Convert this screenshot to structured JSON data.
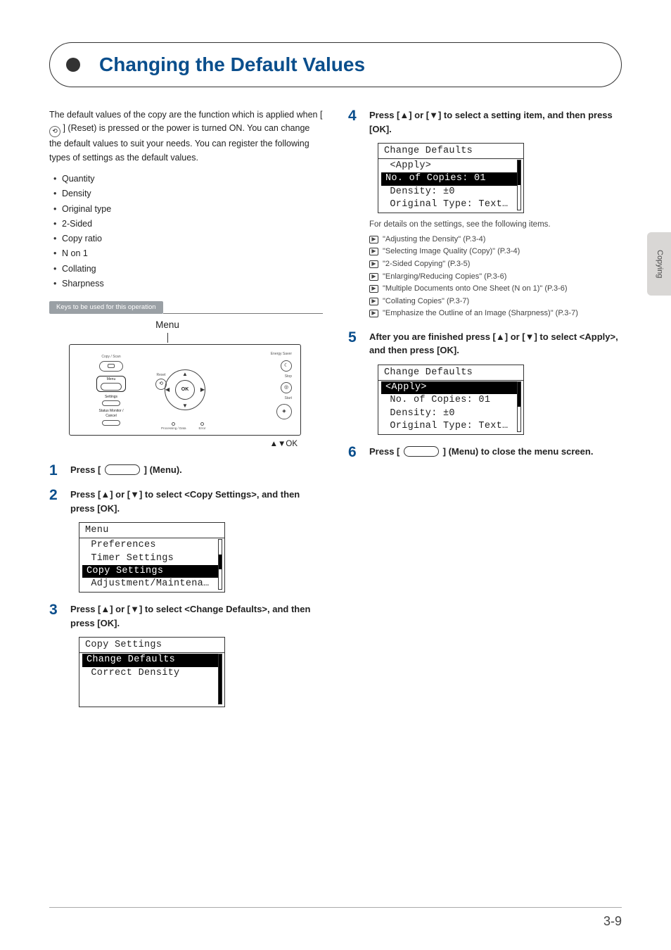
{
  "side_tab": "Copying",
  "section_title": "Changing the Default Values",
  "intro": {
    "p1a": "The default values of the copy are the function which is applied when [",
    "p1b": "] (Reset) is pressed or the power is turned ON. You can change the default values to suit your needs.",
    "p2": "You can register the following types of settings as the default values."
  },
  "bullets": [
    "Quantity",
    "Density",
    "Original type",
    "2-Sided",
    "Copy ratio",
    "N on 1",
    "Collating",
    "Sharpness"
  ],
  "keys_label": "Keys to be used for this operation",
  "menu_label": "Menu",
  "panel_caption": "▲▼OK",
  "panel": {
    "copy_scan": "Copy / Scan",
    "menu_btn": "Menu",
    "settings": "Settings",
    "status": "Status Monitor /\nCancel",
    "reset": "Reset",
    "energy": "Energy Saver",
    "stop": "Stop",
    "start": "Start",
    "processing": "Processing / Data",
    "error": "Error",
    "ok": "OK"
  },
  "steps": {
    "s1": {
      "n": "1",
      "a": "Press [",
      "b": "] (Menu)."
    },
    "s2": {
      "n": "2",
      "t": "Press [▲] or [▼] to select <Copy Settings>, and then press [OK]."
    },
    "s3": {
      "n": "3",
      "t": "Press [▲] or [▼] to select <Change Defaults>, and then press [OK]."
    },
    "s4": {
      "n": "4",
      "t": "Press [▲] or [▼] to select a setting item, and then press [OK]."
    },
    "s5": {
      "n": "5",
      "t": "After you are finished press [▲] or [▼] to select <Apply>, and then press [OK]."
    },
    "s6": {
      "n": "6",
      "a": "Press [",
      "b": "] (Menu) to close the menu screen."
    }
  },
  "lcd_menu": {
    "title": "Menu",
    "r1": " Preferences",
    "r2": " Timer Settings",
    "r3": "Copy Settings",
    "r4": " Adjustment/Maintena…"
  },
  "lcd_copysettings": {
    "title": "Copy Settings",
    "r1": "Change Defaults",
    "r2": " Correct Density"
  },
  "lcd_change1": {
    "title": "Change Defaults",
    "r1": " <Apply>",
    "r2": "No. of Copies: 01",
    "r3": " Density: ±0",
    "r4": " Original Type: Text…"
  },
  "lcd_change2": {
    "title": "Change Defaults",
    "r1": "<Apply>",
    "r2": " No. of Copies: 01",
    "r3": " Density: ±0",
    "r4": " Original Type: Text…"
  },
  "refs": {
    "intro": "For details on the settings, see the following items.",
    "items": [
      "\"Adjusting the Density\" (P.3-4)",
      "\"Selecting Image Quality (Copy)\" (P.3-4)",
      "\"2-Sided Copying\" (P.3-5)",
      "\"Enlarging/Reducing Copies\" (P.3-6)",
      "\"Multiple Documents onto One Sheet (N on 1)\" (P.3-6)",
      "\"Collating Copies\" (P.3-7)",
      "\"Emphasize the Outline of an Image (Sharpness)\" (P.3-7)"
    ]
  },
  "page_num": "3-9"
}
